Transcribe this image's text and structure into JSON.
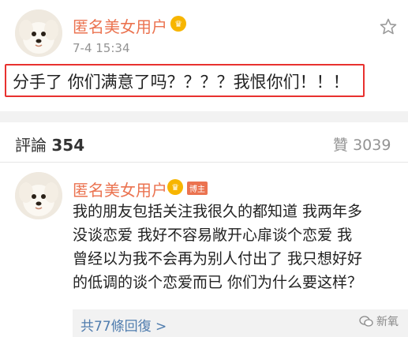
{
  "post": {
    "username": "匿名美女用户",
    "vip_badge": "♛",
    "time": "7-4 15:34",
    "text": "分手了 你们满意了吗？？？？我恨你们！！！"
  },
  "comments_header": {
    "label": "評論",
    "count": "354",
    "likes_label": "贊",
    "likes_count": "3039"
  },
  "comment": {
    "username": "匿名美女用户",
    "vip_badge": "♛",
    "poster_badge": "博主",
    "lines": [
      "我的朋友包括关注我很久的都知道 我两年多",
      "没谈恋爱 我好不容易敞开心扉谈个恋爱 我",
      "曾经以为我不会再为别人付出了 我只想好好",
      "的低调的谈个恋爱而已 你们为什么要这样？"
    ],
    "replies_link": "共77條回復 >"
  },
  "watermark": {
    "text": "新氧"
  }
}
